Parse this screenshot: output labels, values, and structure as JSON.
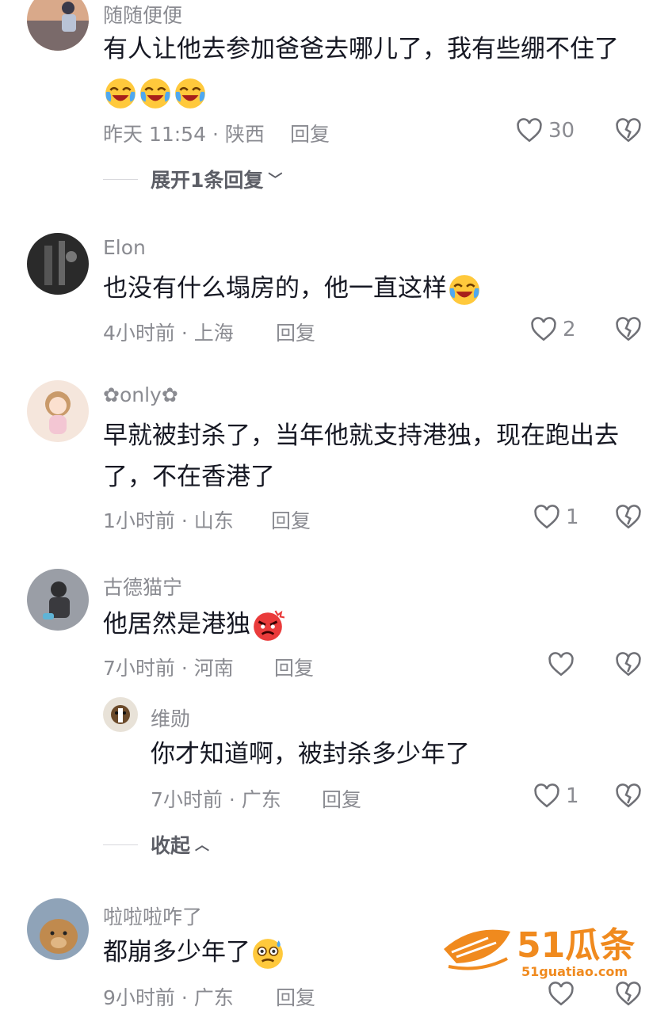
{
  "comments": [
    {
      "username": "随随便便",
      "text": "有人让他去参加爸爸去哪儿了，我有些绷不住了",
      "emojis": [
        "laugh-cry-emoji",
        "laugh-cry-emoji",
        "laugh-cry-emoji"
      ],
      "time_location": "昨天 11:54 · 陕西",
      "reply_label": "回复",
      "likes": "30",
      "expand_label": "展开1条回复"
    },
    {
      "username": "Elon",
      "text": "也没有什么塌房的，他一直这样",
      "emojis": [
        "laugh-cry-emoji"
      ],
      "time_location": "4小时前 · 上海",
      "reply_label": "回复",
      "likes": "2"
    },
    {
      "username": "✿only✿",
      "text_line1": "早就被封杀了，当年他就支持港独，现在跑出去",
      "text_line2": "了，不在香港了",
      "time_location": "1小时前 · 山东",
      "reply_label": "回复",
      "likes": "1"
    },
    {
      "username": "古德猫宁",
      "text": "他居然是港独",
      "emojis": [
        "angry-emoji"
      ],
      "time_location": "7小时前 · 河南",
      "reply_label": "回复",
      "likes": ""
    },
    {
      "username": "维勋",
      "text": "你才知道啊，被封杀多少年了",
      "time_location": "7小时前 · 广东",
      "reply_label": "回复",
      "likes": "1",
      "collapse_label": "收起"
    },
    {
      "username": "啦啦啦咋了",
      "text": "都崩多少年了",
      "emojis": [
        "anxious-emoji"
      ],
      "time_location": "9小时前 · 广东",
      "reply_label": "回复",
      "likes": ""
    }
  ],
  "watermark": {
    "brand": "51瓜条",
    "url": "51guatiao.com"
  },
  "colors": {
    "meta_gray": "#8a8b91",
    "text": "#161823",
    "watermark_orange": "#f08a1e"
  }
}
